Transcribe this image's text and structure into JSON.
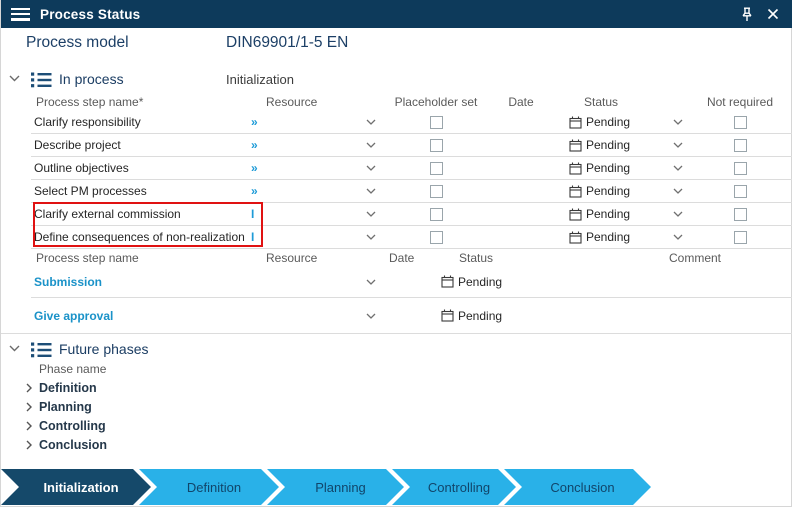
{
  "window": {
    "title": "Process Status"
  },
  "header": {
    "process_model_label": "Process model",
    "process_model_value": "DIN69901/1-5 EN"
  },
  "in_process": {
    "title": "In process",
    "phase": "Initialization",
    "table": {
      "headers": {
        "name": "Process step name*",
        "resource": "Resource",
        "placeholder": "Placeholder set",
        "date": "Date",
        "status": "Status",
        "not_required": "Not required"
      },
      "rows": [
        {
          "name": "Clarify responsibility",
          "resource_mark": "»",
          "status": "Pending"
        },
        {
          "name": "Describe project",
          "resource_mark": "»",
          "status": "Pending"
        },
        {
          "name": "Outline objectives",
          "resource_mark": "»",
          "status": "Pending"
        },
        {
          "name": "Select PM processes",
          "resource_mark": "»",
          "status": "Pending"
        },
        {
          "name": "Clarify external commission",
          "resource_mark": "I",
          "status": "Pending",
          "highlighted": true
        },
        {
          "name": "Define consequences of non-realization",
          "resource_mark": "I",
          "status": "Pending",
          "highlighted": true
        }
      ]
    },
    "approval_table": {
      "headers": {
        "name": "Process step name",
        "resource": "Resource",
        "date": "Date",
        "status": "Status",
        "comment": "Comment"
      },
      "rows": [
        {
          "name": "Submission",
          "status": "Pending"
        },
        {
          "name": "Give approval",
          "status": "Pending"
        }
      ]
    }
  },
  "future_phases": {
    "title": "Future phases",
    "column_header": "Phase name",
    "rows": [
      {
        "name": "Definition"
      },
      {
        "name": "Planning"
      },
      {
        "name": "Controlling"
      },
      {
        "name": "Conclusion"
      }
    ]
  },
  "phase_bar": {
    "items": [
      {
        "label": "Initialization",
        "active": true
      },
      {
        "label": "Definition",
        "active": false
      },
      {
        "label": "Planning",
        "active": false
      },
      {
        "label": "Controlling",
        "active": false
      },
      {
        "label": "Conclusion",
        "active": false
      }
    ]
  },
  "colors": {
    "titlebar": "#0d3a5b",
    "accent_blue": "#29b1e8",
    "link_blue": "#1e9bd7",
    "highlight_red": "#e01212"
  }
}
